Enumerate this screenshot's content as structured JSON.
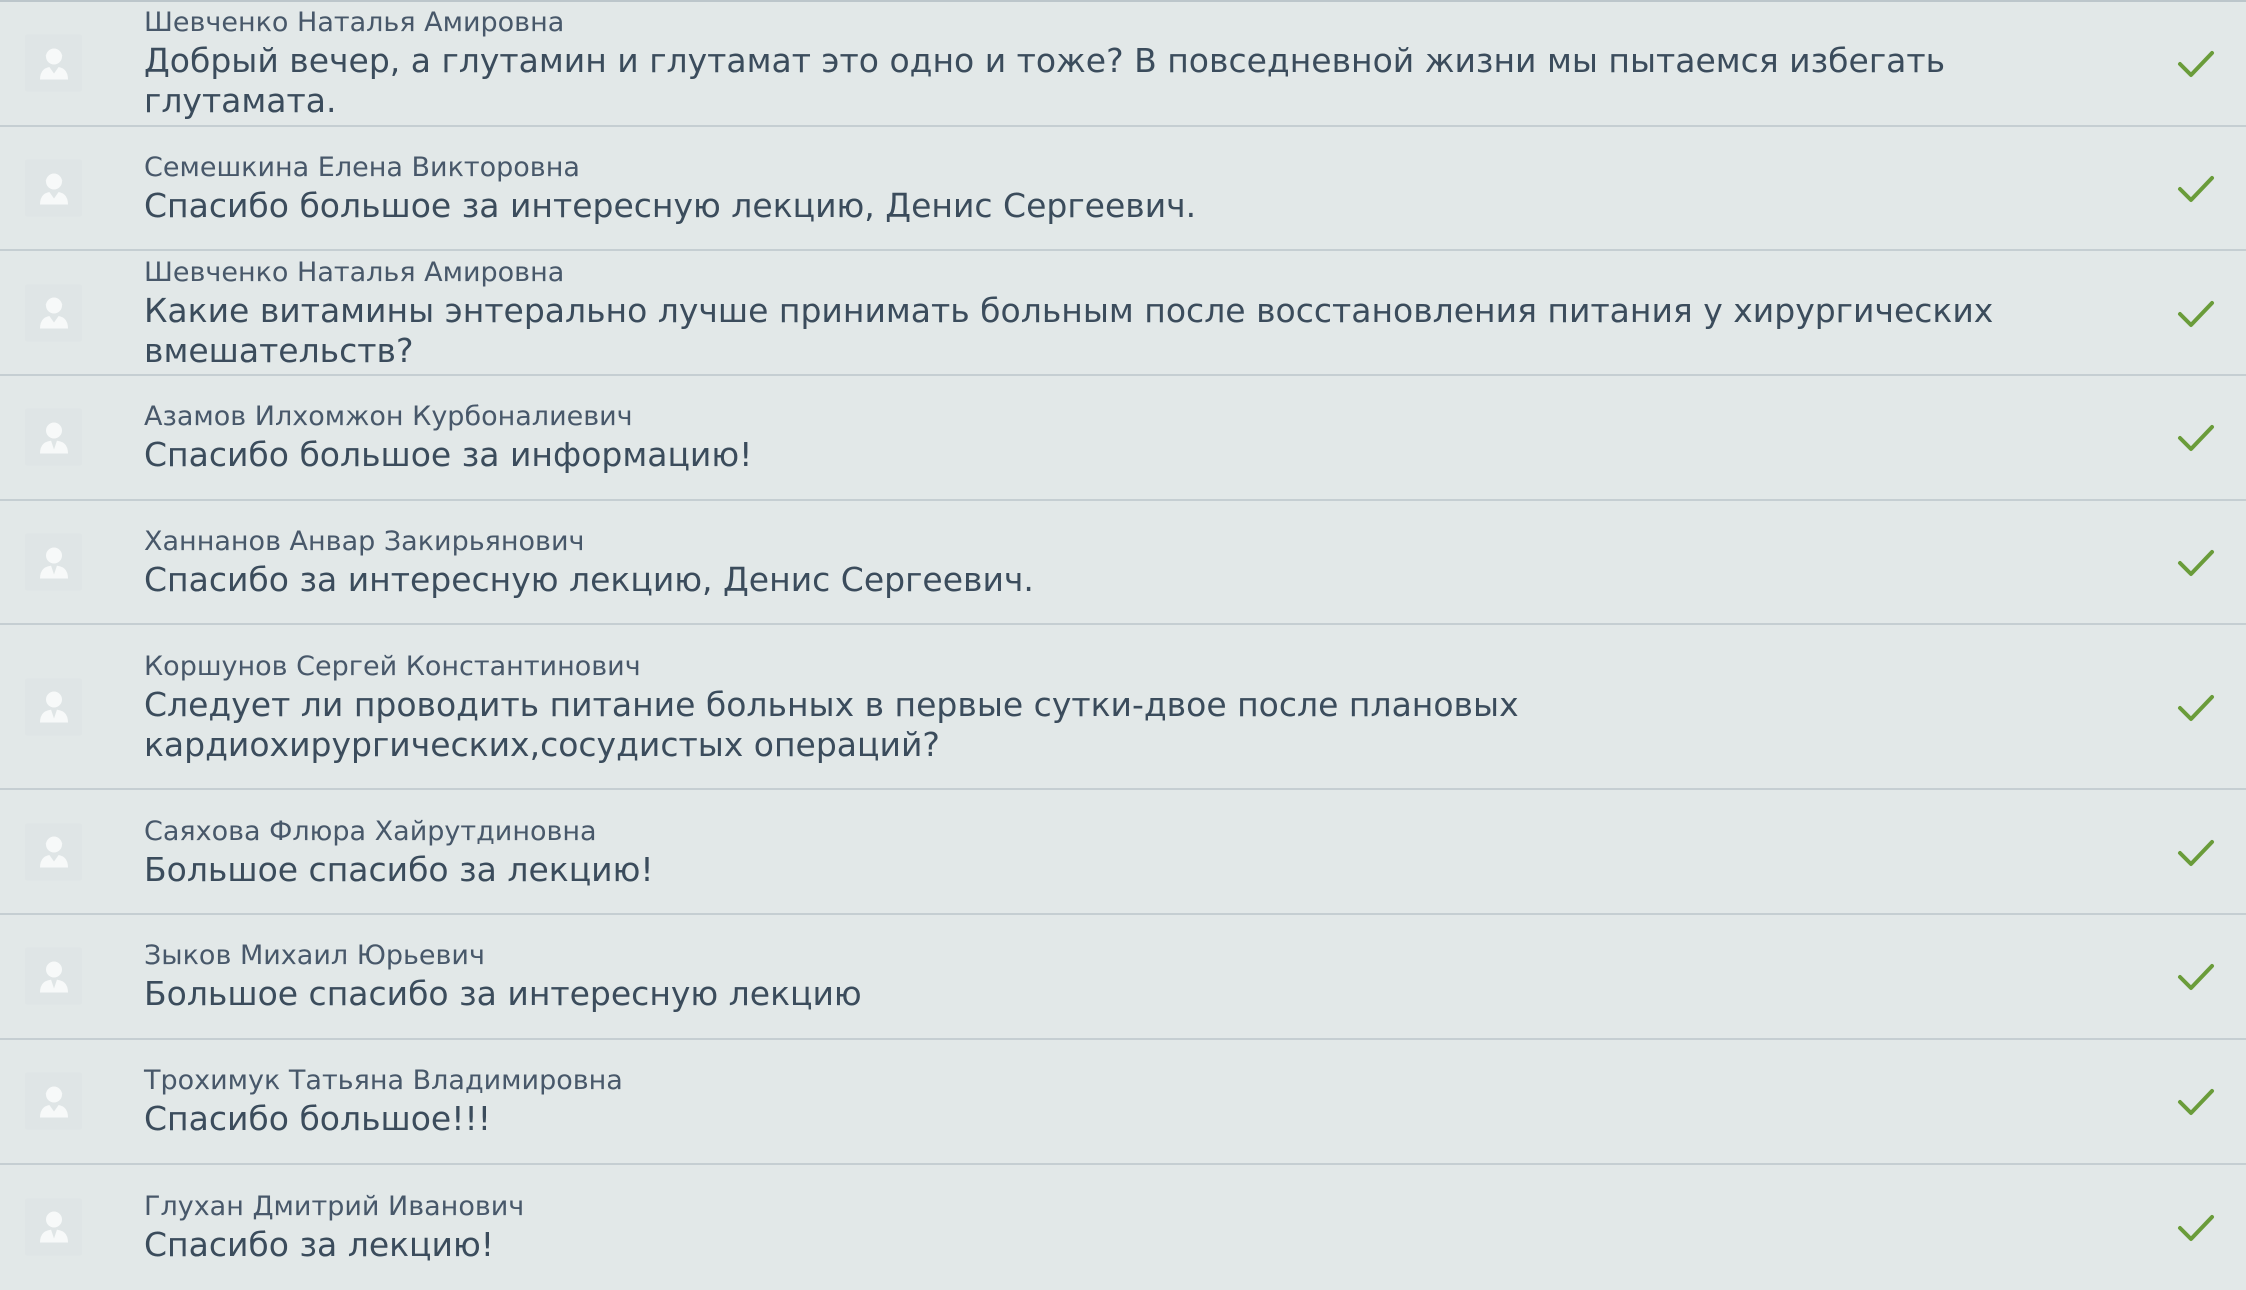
{
  "comments": [
    {
      "author": "Шевченко Наталья Амировна",
      "message": "Добрый вечер, а глутамин и глутамат это одно и тоже? В повседневной жизни мы пытаемся избегать глутамата.",
      "avatar": "female-user-icon",
      "status": "approved-check-icon"
    },
    {
      "author": "Семешкина Елена Викторовна",
      "message": "Спасибо большое за интересную лекцию, Денис Сергеевич.",
      "avatar": "female-user-icon",
      "status": "approved-check-icon"
    },
    {
      "author": "Шевченко Наталья Амировна",
      "message": "Какие витамины энтерально лучше принимать больным после восстановления питания у хирургических вмешательств?",
      "avatar": "female-user-icon",
      "status": "approved-check-icon"
    },
    {
      "author": "Азамов Илхомжон Курбоналиевич",
      "message": "Спасибо большое за информацию!",
      "avatar": "male-user-icon",
      "status": "approved-check-icon"
    },
    {
      "author": "Ханнанов Анвар Закирьянович",
      "message": "Спасибо за интересную лекцию, Денис Сергеевич.",
      "avatar": "male-user-icon",
      "status": "approved-check-icon"
    },
    {
      "author": "Коршунов Сергей Константинович",
      "message": "Следует ли проводить питание больных в первые сутки-двое после плановых кардиохирургических,сосудистых операций?",
      "avatar": "male-user-icon",
      "status": "approved-check-icon"
    },
    {
      "author": "Саяхова Флюра Хайрутдиновна",
      "message": "Большое спасибо за лекцию!",
      "avatar": "female-user-icon",
      "status": "approved-check-icon"
    },
    {
      "author": "Зыков Михаил Юрьевич",
      "message": "Большое спасибо за интересную лекцию",
      "avatar": "male-user-icon",
      "status": "approved-check-icon"
    },
    {
      "author": "Трохимук Татьяна Владимировна",
      "message": "Спасибо большое!!!",
      "avatar": "female-user-icon",
      "status": "approved-check-icon"
    },
    {
      "author": "Глухан Дмитрий Иванович",
      "message": "Спасибо за лекцию!",
      "avatar": "male-user-icon",
      "status": "approved-check-icon"
    }
  ],
  "colors": {
    "background": "#e2e8e8",
    "divider": "#c5ced2",
    "text": "#3b4c5c",
    "check": "#6a9c3a"
  }
}
